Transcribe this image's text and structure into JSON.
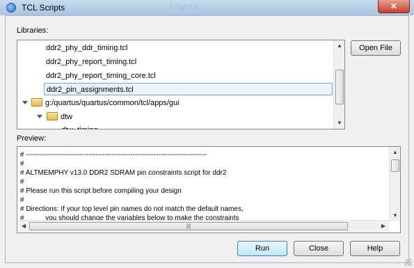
{
  "window": {
    "title": "TCL Scripts",
    "close": "✕",
    "background_ghost_text": "Layout"
  },
  "libraries": {
    "label": "Libraries:",
    "items": [
      "ddr2_phy_ddr_timing.tcl",
      "ddr2_phy_report_timing.tcl",
      "ddr2_phy_report_timing_core.tcl",
      "ddr2_pin_assignments.tcl",
      "g:/quartus/quartus/common/tcl/apps/gui",
      "dtw",
      "dtw_timing..."
    ],
    "selected": "ddr2_pin_assignments.tcl"
  },
  "open_file_label": "Open File",
  "preview": {
    "label": "Preview:",
    "lines": [
      "# ------------------------------------------------------------------------------",
      "#",
      "# ALTMEMPHY v13.0 DDR2 SDRAM pin constraints script for ddr2",
      "#",
      "# Please run this script before compiling your design",
      "#",
      "# Directions: If your top level pin names do not match the default names,",
      "#           you should change the variables below to make the constraints"
    ]
  },
  "buttons": {
    "run": "Run",
    "close": "Close",
    "help": "Help"
  }
}
